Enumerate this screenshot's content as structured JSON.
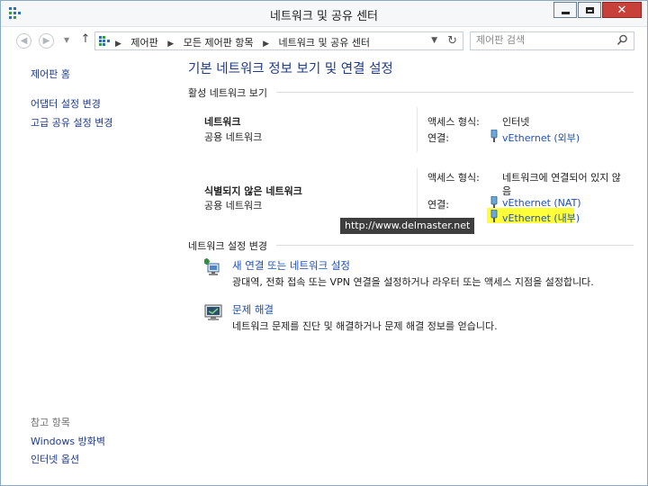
{
  "window": {
    "title": "네트워크 및 공유 센터",
    "icon": "network-center-icon",
    "buttons": [
      "minimize",
      "maximize",
      "close"
    ]
  },
  "nav": {
    "back_icon": "back-arrow-icon",
    "forward_icon": "forward-arrow-icon",
    "up_icon": "up-arrow-icon",
    "breadcrumbs": [
      "제어판",
      "모든 제어판 항목",
      "네트워크 및 공유 센터"
    ],
    "search_placeholder": "제어판 검색"
  },
  "sidebar": {
    "home": "제어판 홈",
    "links": [
      "어댑터 설정 변경",
      "고급 공유 설정 변경"
    ],
    "see_also_label": "참고 항목",
    "see_also": [
      "Windows 방화벽",
      "인터넷 옵션"
    ]
  },
  "main": {
    "title": "기본 네트워크 정보 보기 및 연결 설정",
    "active_networks_heading": "활성 네트워크 보기",
    "networks": [
      {
        "name": "네트워크",
        "category": "공용 네트워크",
        "access_label": "액세스 형식:",
        "access_value": "인터넷",
        "connections_label": "연결:",
        "connections": [
          "vEthernet (외부)"
        ]
      },
      {
        "name": "식별되지 않은 네트워크",
        "category": "공용 네트워크",
        "access_label": "액세스 형식:",
        "access_value_line1": "네트워크에 연결되어 있지 않",
        "access_value_line2": "음",
        "connections_label": "연결:",
        "connections": [
          "vEthernet (NAT)",
          "vEthernet (내부)"
        ]
      }
    ],
    "watermark": "http://www.delmaster.net",
    "change_settings_heading": "네트워크 설정 변경",
    "tasks": [
      {
        "title": "새 연결 또는 네트워크 설정",
        "description": "광대역, 전화 접속 또는 VPN 연결을 설정하거나 라우터 또는 액세스 지점을 설정합니다.",
        "icon": "new-connection-icon"
      },
      {
        "title": "문제 해결",
        "description": "네트워크 문제를 진단 및 해결하거나 문제 해결 정보를 얻습니다.",
        "icon": "troubleshoot-icon"
      }
    ],
    "highlight_color": "#ffff3a",
    "link_color": "#1f4fb5"
  }
}
